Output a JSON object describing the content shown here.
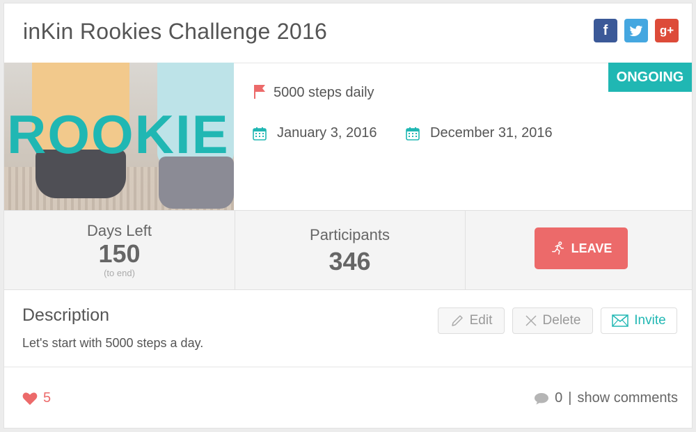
{
  "challenge": {
    "title": "inKin Rookies Challenge 2016",
    "status": "ONGOING",
    "hero_text": "ROOKIE",
    "goal": "5000 steps daily",
    "start_date": "January 3, 2016",
    "end_date": "December 31, 2016"
  },
  "social": {
    "facebook": "f",
    "twitter": "t",
    "google_plus": "g+"
  },
  "stats": {
    "days_left_label": "Days Left",
    "days_left_value": "150",
    "days_left_sub": "(to end)",
    "participants_label": "Participants",
    "participants_value": "346",
    "leave_label": "LEAVE"
  },
  "description": {
    "title": "Description",
    "text": "Let's start with 5000 steps a day.",
    "edit_label": "Edit",
    "delete_label": "Delete",
    "invite_label": "Invite"
  },
  "footer": {
    "likes_count": "5",
    "comments_count": "0",
    "separator": "|",
    "show_comments_label": "show comments"
  },
  "colors": {
    "accent": "#20b7b3",
    "danger": "#ec6a6a",
    "facebook": "#3b5998",
    "twitter": "#45a7e0",
    "google_plus": "#dd4b39"
  },
  "icons": {
    "goal": "flag-icon",
    "dates": "calendar-icon",
    "leave": "runner-icon",
    "edit": "pencil-icon",
    "delete": "close-icon",
    "invite": "envelope-icon",
    "likes": "heart-icon",
    "comments": "comment-bubble-icon"
  }
}
